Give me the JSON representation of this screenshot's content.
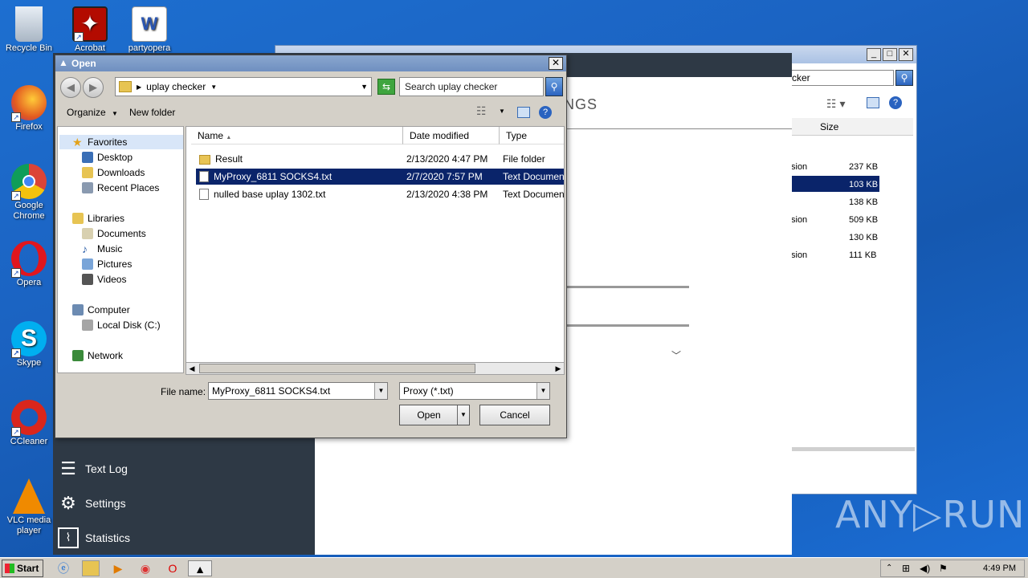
{
  "desktop": {
    "icons": [
      {
        "label": "Recycle Bin",
        "icon": "recycle-bin-icon"
      },
      {
        "label": "Acrobat",
        "icon": "acrobat-icon"
      },
      {
        "label": "partyopera",
        "icon": "word-doc-icon"
      },
      {
        "label": "Firefox",
        "icon": "firefox-icon"
      },
      {
        "label": "Google Chrome",
        "icon": "chrome-icon"
      },
      {
        "label": "Opera",
        "icon": "opera-icon"
      },
      {
        "label": "Skype",
        "icon": "skype-icon"
      },
      {
        "label": "CCleaner",
        "icon": "ccleaner-icon"
      },
      {
        "label": "VLC media player",
        "icon": "vlc-icon"
      }
    ]
  },
  "bg_explorer": {
    "search_fragment": "cker",
    "col_size": "Size",
    "rows": [
      {
        "type": "sion",
        "size": "237 KB"
      },
      {
        "type": "",
        "size": "103 KB"
      },
      {
        "type": "",
        "size": "138 KB"
      },
      {
        "type": "sion",
        "size": "509 KB"
      },
      {
        "type": "",
        "size": "130 KB"
      },
      {
        "type": "sion",
        "size": "111 KB"
      }
    ]
  },
  "app": {
    "heading_fragment": "NGS",
    "side": [
      {
        "label": "Text Log",
        "icon": "list-icon"
      },
      {
        "label": "Settings",
        "icon": "gear-icon"
      },
      {
        "label": "Statistics",
        "icon": "chart-icon"
      }
    ]
  },
  "dialog": {
    "title": "Open",
    "address": "uplay checker",
    "search_placeholder": "Search uplay checker",
    "organize": "Organize",
    "new_folder": "New folder",
    "nav": {
      "favorites": "Favorites",
      "desktop": "Desktop",
      "downloads": "Downloads",
      "recent": "Recent Places",
      "libraries": "Libraries",
      "documents": "Documents",
      "music": "Music",
      "pictures": "Pictures",
      "videos": "Videos",
      "computer": "Computer",
      "local_disk": "Local Disk (C:)",
      "network": "Network"
    },
    "columns": {
      "name": "Name",
      "date": "Date modified",
      "type": "Type"
    },
    "files": [
      {
        "name": "Result",
        "date": "2/13/2020 4:47 PM",
        "type": "File folder",
        "kind": "folder"
      },
      {
        "name": "MyProxy_6811 SOCKS4.txt",
        "date": "2/7/2020 7:57 PM",
        "type": "Text Document",
        "kind": "txt"
      },
      {
        "name": "nulled base uplay 1302.txt",
        "date": "2/13/2020 4:38 PM",
        "type": "Text Document",
        "kind": "txt"
      }
    ],
    "file_name_label": "File name:",
    "file_name_value": "MyProxy_6811 SOCKS4.txt",
    "filter_value": "Proxy (*.txt)",
    "open_button": "Open",
    "cancel_button": "Cancel"
  },
  "taskbar": {
    "start": "Start",
    "clock": "4:49 PM"
  },
  "watermark": "ANY▷RUN"
}
